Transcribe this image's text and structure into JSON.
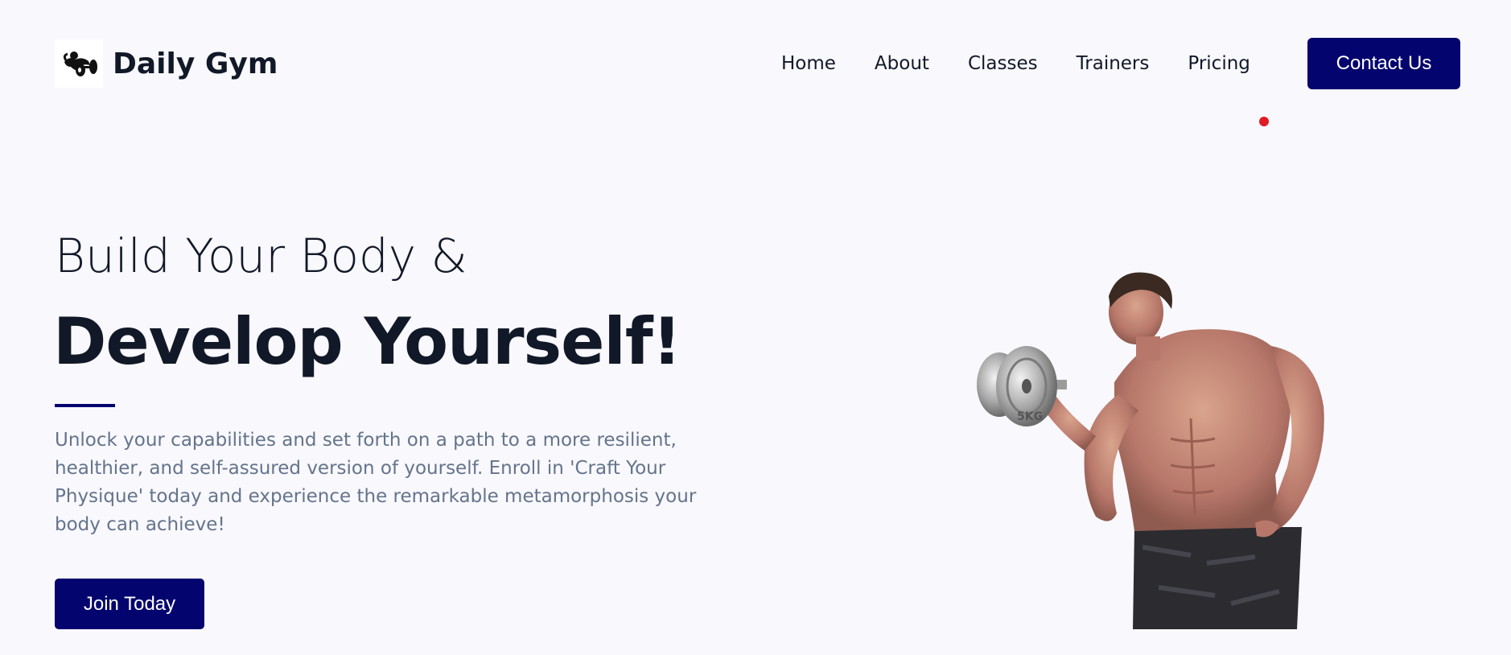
{
  "header": {
    "brand": "Daily Gym",
    "logo_icon": "bodybuilder-dumbbell-icon",
    "nav": [
      {
        "label": "Home"
      },
      {
        "label": "About"
      },
      {
        "label": "Classes"
      },
      {
        "label": "Trainers"
      },
      {
        "label": "Pricing"
      }
    ],
    "contact_label": "Contact Us"
  },
  "hero": {
    "line1": "Build Your Body &",
    "line2": "Develop Yourself!",
    "description": "Unlock your capabilities and set forth on a path to a more resilient, healthier, and self-assured version of yourself. Enroll in 'Craft Your Physique' today and experience the remarkable metamorphosis your body can achieve!",
    "cta_label": "Join Today",
    "image": "muscular-man-lifting-dumbbell",
    "dumbbell_text": "5KG"
  },
  "colors": {
    "background": "#f8f8fd",
    "primary": "#04046e",
    "text": "#111827",
    "muted": "#64748b",
    "indicator": "#e01b24"
  }
}
